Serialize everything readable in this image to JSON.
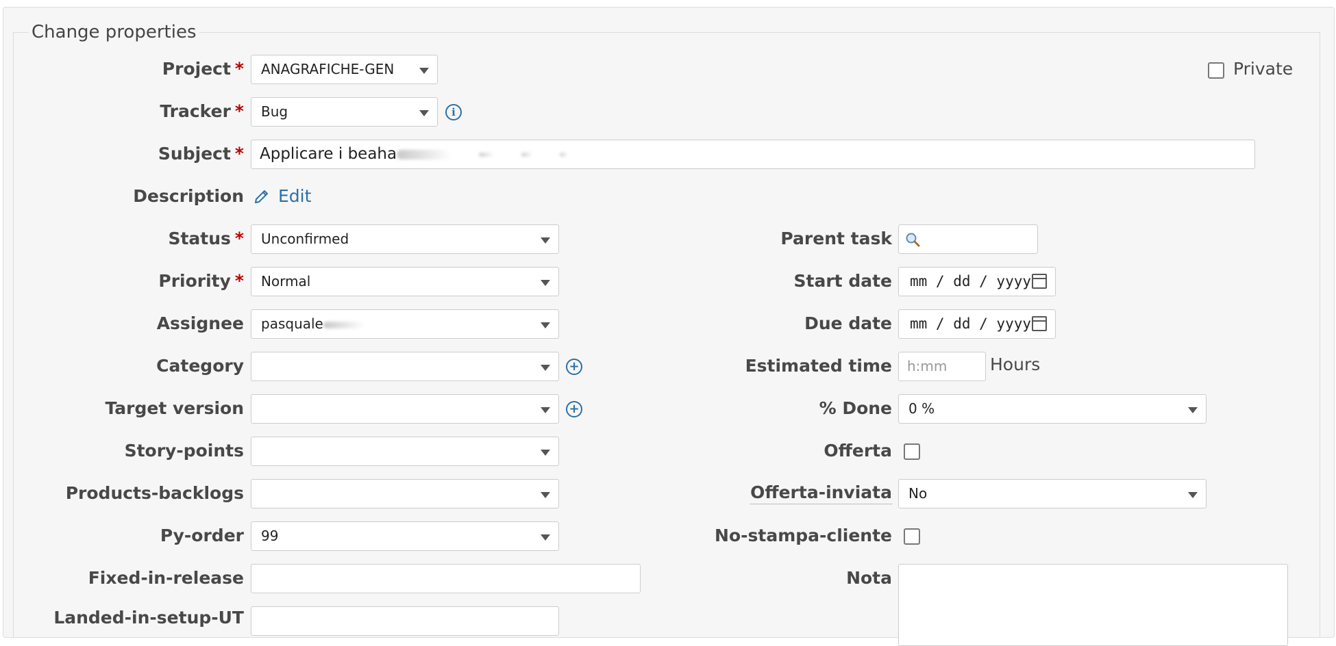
{
  "fieldset": {
    "legend": "Change properties"
  },
  "private": {
    "label": "Private",
    "checked": false
  },
  "project": {
    "label": "Project",
    "value": "ANAGRAFICHE-GEN",
    "required": "*"
  },
  "tracker": {
    "label": "Tracker",
    "value": "Bug",
    "required": "*"
  },
  "subject": {
    "label": "Subject",
    "value": "Applicare i beaha",
    "required": "*"
  },
  "description": {
    "label": "Description",
    "edit_label": "Edit"
  },
  "status": {
    "label": "Status",
    "value": "Unconfirmed",
    "required": "*"
  },
  "priority": {
    "label": "Priority",
    "value": "Normal",
    "required": "*"
  },
  "assignee": {
    "label": "Assignee",
    "value": "pasquale"
  },
  "category": {
    "label": "Category",
    "value": ""
  },
  "target_version": {
    "label": "Target version",
    "value": ""
  },
  "story_points": {
    "label": "Story-points",
    "value": ""
  },
  "products_backlogs": {
    "label": "Products-backlogs",
    "value": ""
  },
  "py_order": {
    "label": "Py-order",
    "value": "99"
  },
  "fixed_in_release": {
    "label": "Fixed-in-release",
    "value": ""
  },
  "landed_in_setup": {
    "label": "Landed-in-setup-UT"
  },
  "parent_task": {
    "label": "Parent task",
    "value": ""
  },
  "start_date": {
    "label": "Start date",
    "placeholder": "mm / dd / yyyy"
  },
  "due_date": {
    "label": "Due date",
    "placeholder": "mm / dd / yyyy"
  },
  "estimated_time": {
    "label": "Estimated time",
    "placeholder": "h:mm",
    "unit": "Hours"
  },
  "done": {
    "label": "% Done",
    "value": "0 %"
  },
  "offerta": {
    "label": "Offerta",
    "checked": false
  },
  "offerta_inviata": {
    "label": "Offerta-inviata",
    "value": "No"
  },
  "no_stampa_cliente": {
    "label": "No-stampa-cliente",
    "checked": false
  },
  "nota": {
    "label": "Nota",
    "value": ""
  },
  "icons": {
    "info": "info-icon",
    "add": "plus-icon",
    "edit": "pencil-icon",
    "search": "search-icon",
    "calendar": "calendar-icon"
  },
  "colors": {
    "required": "#bb0000",
    "link": "#2a70a8",
    "panel": "#f6f6f6"
  }
}
